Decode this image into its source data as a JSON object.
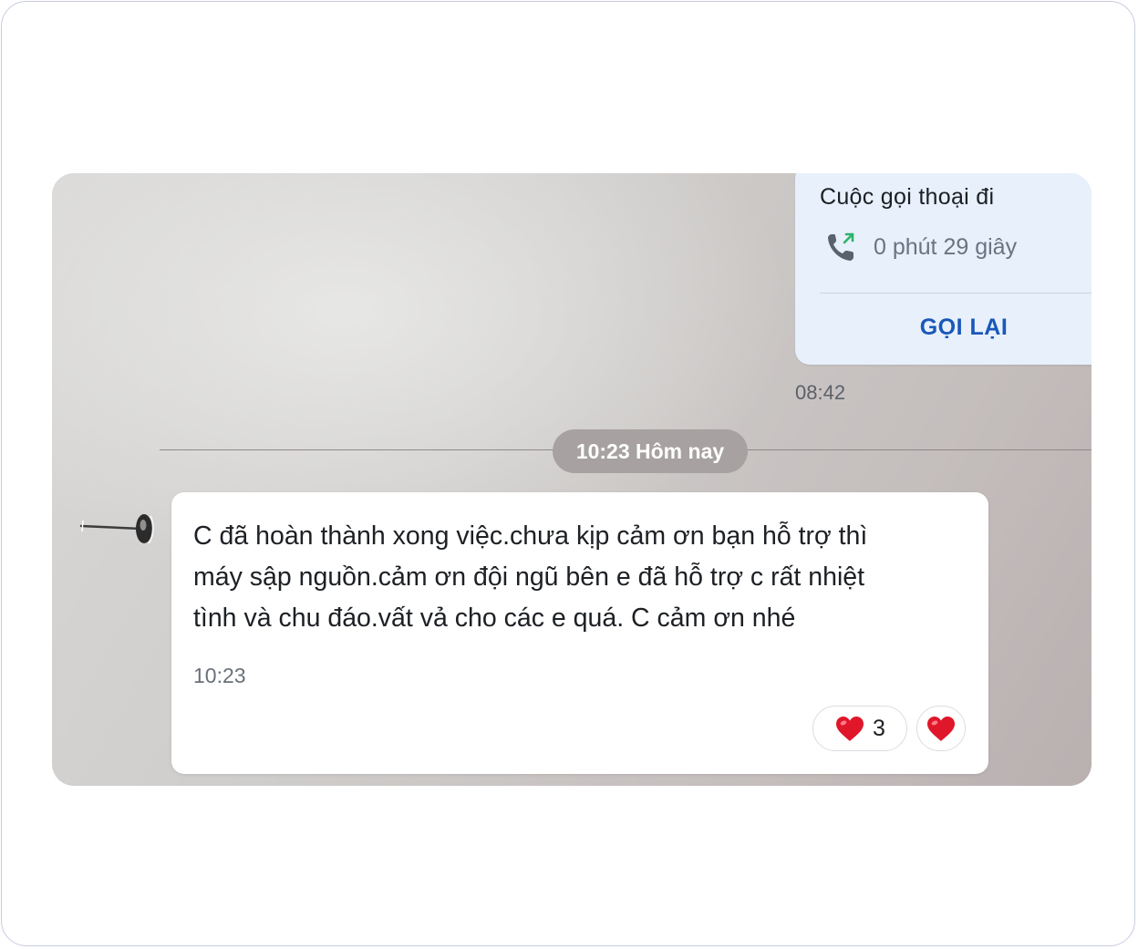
{
  "call": {
    "title": "Cuộc gọi thoại đi",
    "duration": "0 phút 29 giây",
    "call_back_label": "GỌI LẠI",
    "time": "08:42",
    "icon": "outgoing-call-icon"
  },
  "separator": {
    "label": "10:23 Hôm nay"
  },
  "message": {
    "line1": "C đã hoàn thành xong việc.chưa kịp cảm ơn bạn hỗ trợ thì",
    "line2": "máy sập nguồn.cảm ơn đội ngũ bên e đã  hỗ trợ c rất nhiệt",
    "line3": "tình và chu đáo.vất vả cho các e quá. C cảm ơn nhé",
    "time": "10:23",
    "reactions": {
      "heart_count": "3",
      "icon": "heart-icon"
    }
  },
  "colors": {
    "call_bubble": "#e7f0fb",
    "call_back": "#1a57b8",
    "heart": "#e0162b"
  }
}
